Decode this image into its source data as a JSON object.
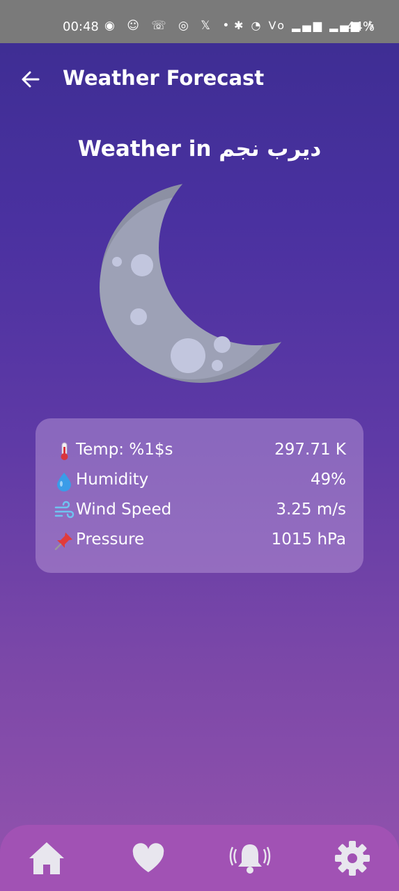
{
  "status_bar": {
    "time": "00:48",
    "icons_left": "◉ ☺ ☏ ◎ 𝕏 •",
    "icons_right": "✱ ◔ Vo ▂▄▆ ▂▄▆ ϟ",
    "battery": "44%"
  },
  "app_bar": {
    "title": "Weather Forecast",
    "back_icon": "arrow-left-icon"
  },
  "main": {
    "heading": "Weather in ديرب نجم",
    "weather_icon": "crescent-moon-icon"
  },
  "details": [
    {
      "icon": "thermometer-icon",
      "label": "Temp: %1$s",
      "value": "297.71 K"
    },
    {
      "icon": "droplet-icon",
      "label": "Humidity",
      "value": "49%"
    },
    {
      "icon": "wind-icon",
      "label": "Wind Speed",
      "value": "3.25 m/s"
    },
    {
      "icon": "pushpin-icon",
      "label": "Pressure",
      "value": "1015 hPa"
    }
  ],
  "bottom_nav": [
    {
      "icon": "home-icon"
    },
    {
      "icon": "heart-icon"
    },
    {
      "icon": "bell-icon"
    },
    {
      "icon": "gear-icon"
    }
  ],
  "colors": {
    "gradient_top": "#3c2d91",
    "gradient_bottom": "#9453ad",
    "card": "#c8aae1",
    "nav_bar": "#a152b4",
    "nav_icon": "#e8e6ee"
  }
}
